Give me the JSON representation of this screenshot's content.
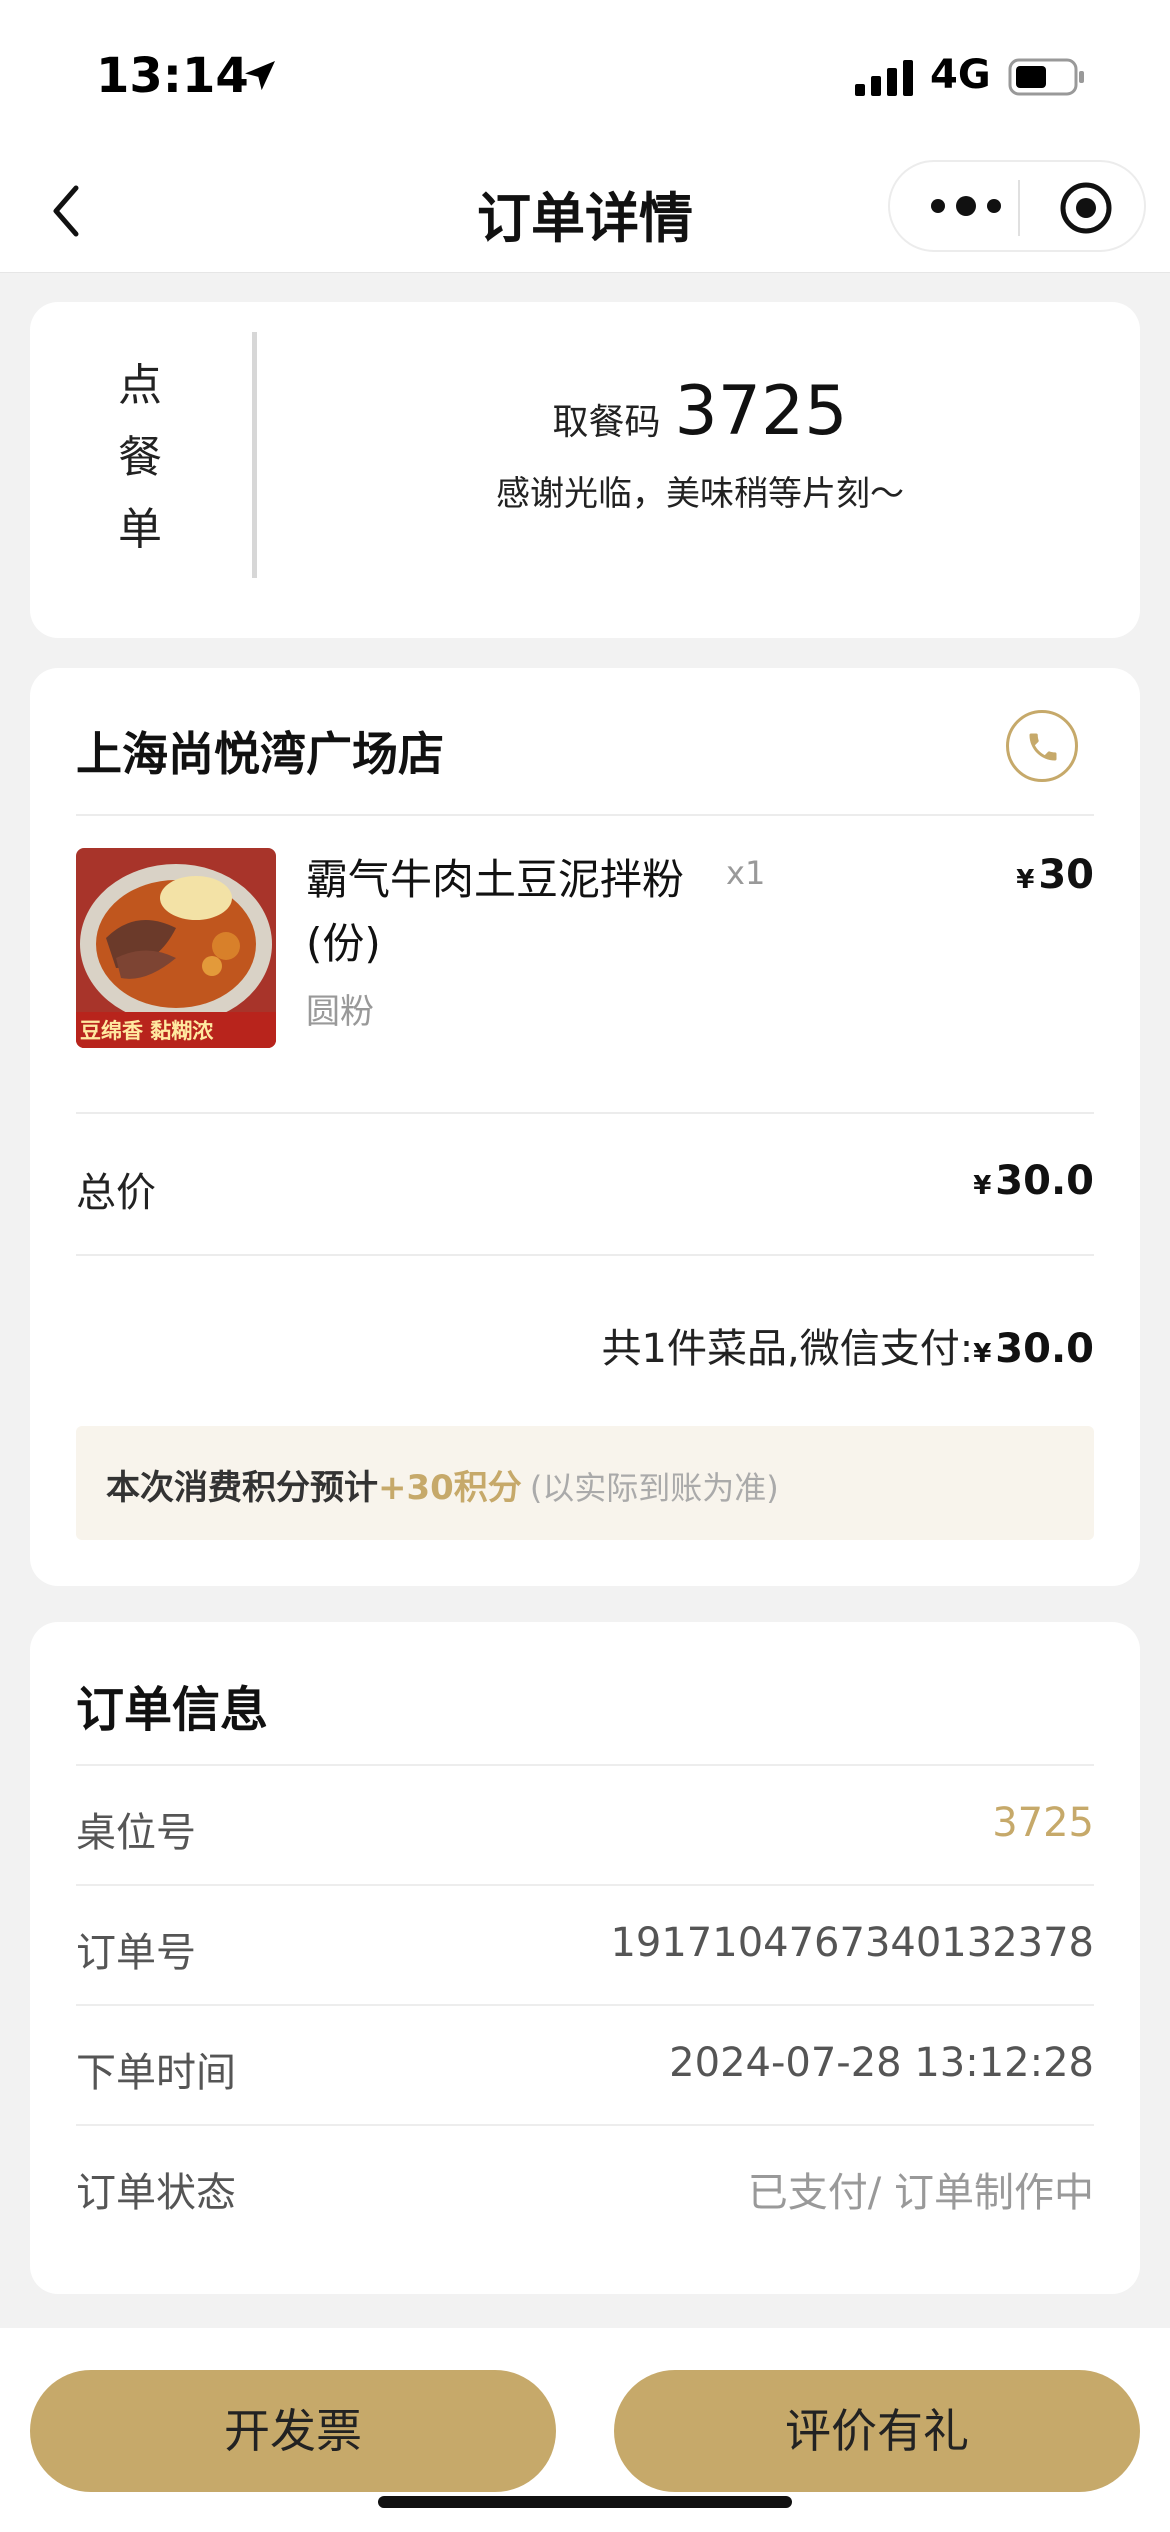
{
  "status_bar": {
    "time": "13:14",
    "network": "4G"
  },
  "nav": {
    "title": "订单详情"
  },
  "pickup_card": {
    "side_label_chars": [
      "点",
      "餐",
      "单"
    ],
    "code_label": "取餐码",
    "code": "3725",
    "message": "感谢光临，美味稍等片刻～"
  },
  "order_card": {
    "store_name": "上海尚悦湾广场店",
    "item": {
      "name": "霸气牛肉土豆泥拌粉(份)",
      "spec": "圆粉",
      "qty": "x1",
      "price": "30",
      "thumb_text": "豆绵香 黏糊浓"
    },
    "currency": "¥",
    "total_label": "总价",
    "total_value": "30.0",
    "summary_prefix": "共1件菜品,微信支付:",
    "summary_value": "30.0",
    "points_prefix": "本次消费积分预计",
    "points_value": "+30积分",
    "points_note": "(以实际到账为准)"
  },
  "info_card": {
    "title": "订单信息",
    "rows": [
      {
        "label": "桌位号",
        "value": "3725"
      },
      {
        "label": "订单号",
        "value": "1917104767340132378"
      },
      {
        "label": "下单时间",
        "value": "2024-07-28 13:12:28"
      },
      {
        "label": "订单状态",
        "value": "已支付/ 订单制作中"
      }
    ]
  },
  "actions": {
    "invoice": "开发票",
    "review": "评价有礼"
  },
  "colors": {
    "accent": "#c6a96a",
    "points_bg": "#f8f4ec",
    "page_bg": "#f2f2f2"
  }
}
